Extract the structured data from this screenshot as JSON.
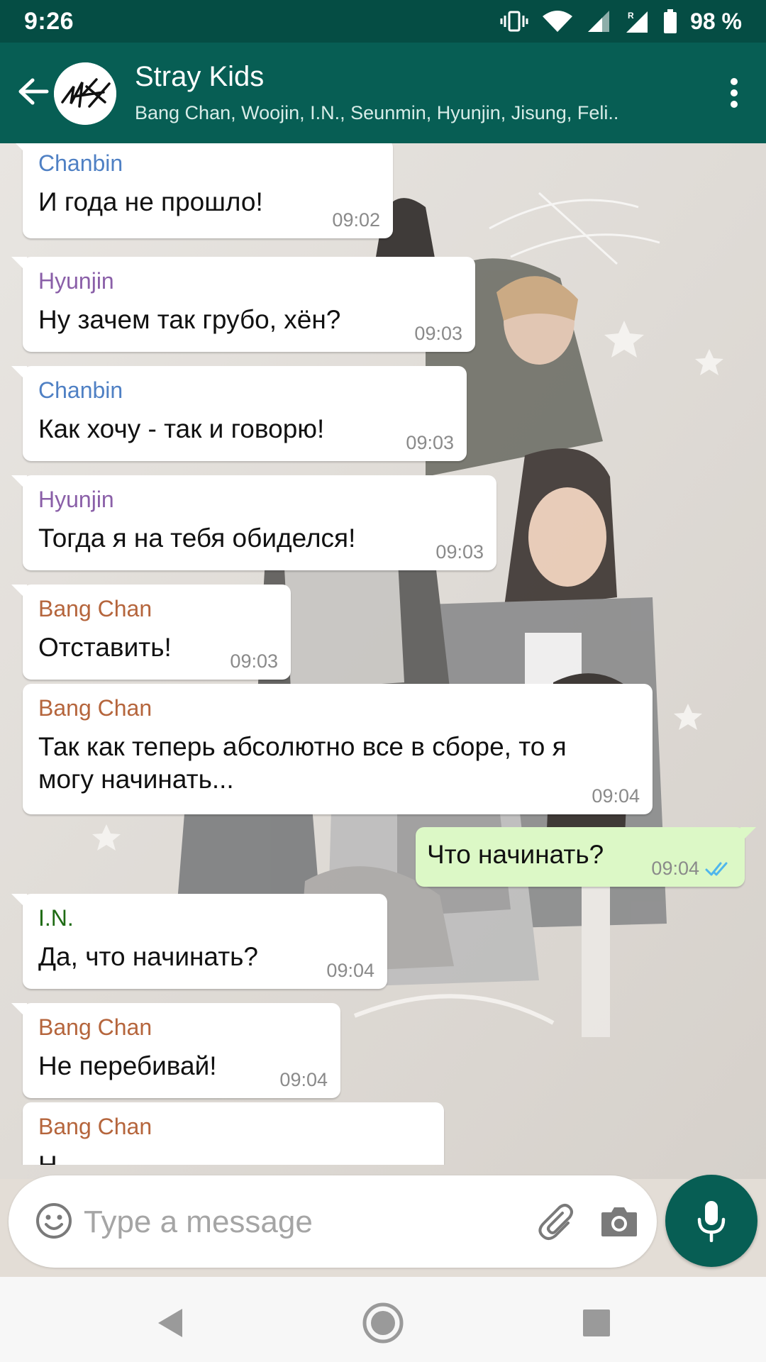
{
  "status_bar": {
    "time": "9:26",
    "battery": "98 %"
  },
  "header": {
    "title": "Stray Kids",
    "members": "Bang Chan, Woojin, I.N., Seunmin, Hyunjin, Jisung, Feli.."
  },
  "colors": {
    "header": "#075e54",
    "status_bar": "#054d44",
    "outgoing_bubble": "#dcf8c6",
    "chanbin": "#4f80c4",
    "hyunjin": "#8a5fa8",
    "bang_chan": "#b5653c",
    "in": "#1f6b14",
    "read_ticks": "#4fb6ec"
  },
  "messages": [
    {
      "sender": "Chanbin",
      "text": "И года не прошло!",
      "time": "09:02"
    },
    {
      "sender": "Hyunjin",
      "text": "Ну зачем так грубо, хён?",
      "time": "09:03"
    },
    {
      "sender": "Chanbin",
      "text": "Как хочу - так и говорю!",
      "time": "09:03"
    },
    {
      "sender": "Hyunjin",
      "text": "Тогда я на тебя обиделся!",
      "time": "09:03"
    },
    {
      "sender": "Bang Chan",
      "text": "Отставить!",
      "time": "09:03"
    },
    {
      "sender": "Bang Chan",
      "text": "Так как теперь абсолютно все в сборе, то я могу начинать...",
      "time": "09:04"
    },
    {
      "sender": "",
      "text": "Что начинать?",
      "time": "09:04",
      "status": "read"
    },
    {
      "sender": "I.N.",
      "text": "Да, что начинать?",
      "time": "09:04"
    },
    {
      "sender": "Bang Chan",
      "text": "Не перебивай!",
      "time": "09:04"
    },
    {
      "sender": "Bang Chan",
      "text": "Н",
      "time": ""
    }
  ],
  "input": {
    "placeholder": "Type a message"
  },
  "icons": {
    "back": "arrow-left-icon",
    "menu": "more-vert-icon",
    "emoji": "smiley-icon",
    "attach": "paperclip-icon",
    "camera": "camera-icon",
    "mic": "microphone-icon"
  }
}
